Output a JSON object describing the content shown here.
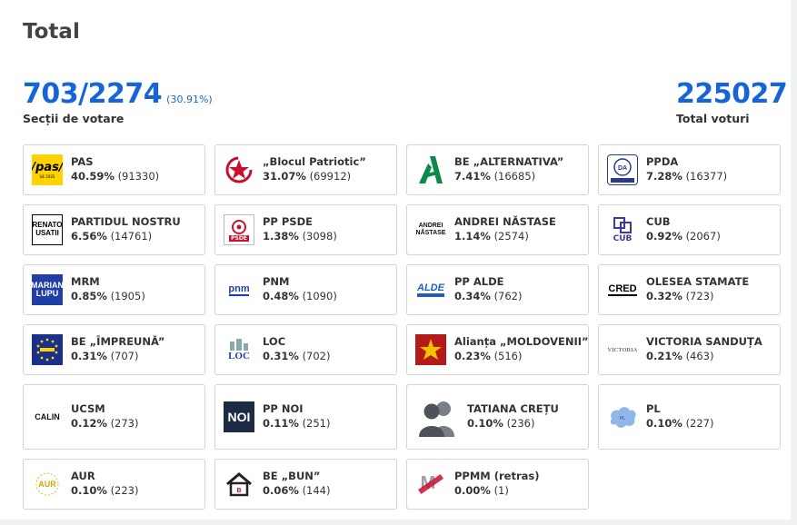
{
  "title": "Total",
  "stations": {
    "value": "703/2274",
    "percent": "(30.91%)",
    "label": "Secții de votare"
  },
  "votes": {
    "value": "225027",
    "label": "Total voturi"
  },
  "parties": [
    {
      "name": "PAS",
      "pct": "40.59%",
      "votes": "(91330)",
      "logo": "pas-logo",
      "logo_text": "/pas/"
    },
    {
      "name": "„Blocul Patriotic”",
      "pct": "31.07%",
      "votes": "(69912)",
      "logo": "red-star-logo",
      "logo_text": ""
    },
    {
      "name": "BE „ALTERNATIVA”",
      "pct": "7.41%",
      "votes": "(16685)",
      "logo": "alternativa-logo",
      "logo_text": ""
    },
    {
      "name": "PPDA",
      "pct": "7.28%",
      "votes": "(16377)",
      "logo": "ppda-logo",
      "logo_text": "DA"
    },
    {
      "name": "PARTIDUL NOSTRU",
      "pct": "6.56%",
      "votes": "(14761)",
      "logo": "renato-usatii-logo",
      "logo_text": "RENATO USATII"
    },
    {
      "name": "PP PSDE",
      "pct": "1.38%",
      "votes": "(3098)",
      "logo": "psde-logo",
      "logo_text": "PSDE"
    },
    {
      "name": "ANDREI NĂSTASE",
      "pct": "1.14%",
      "votes": "(2574)",
      "logo": "andrei-nastase-logo",
      "logo_text": "ANDREI NĂSTASE"
    },
    {
      "name": "CUB",
      "pct": "0.92%",
      "votes": "(2067)",
      "logo": "cub-logo",
      "logo_text": "CUB"
    },
    {
      "name": "MRM",
      "pct": "0.85%",
      "votes": "(1905)",
      "logo": "marian-lupu-logo",
      "logo_text": "MARIAN LUPU"
    },
    {
      "name": "PNM",
      "pct": "0.48%",
      "votes": "(1090)",
      "logo": "pnm-logo",
      "logo_text": "pnm"
    },
    {
      "name": "PP ALDE",
      "pct": "0.34%",
      "votes": "(762)",
      "logo": "alde-logo",
      "logo_text": "ALDE"
    },
    {
      "name": "OLESEA STAMATE",
      "pct": "0.32%",
      "votes": "(723)",
      "logo": "cred-logo",
      "logo_text": "CRED"
    },
    {
      "name": "BE „ÎMPREUNĂ”",
      "pct": "0.31%",
      "votes": "(707)",
      "logo": "impreuna-logo",
      "logo_text": ""
    },
    {
      "name": "LOC",
      "pct": "0.31%",
      "votes": "(702)",
      "logo": "loc-logo",
      "logo_text": "LOC"
    },
    {
      "name": "Alianța „MOLDOVENII”",
      "pct": "0.23%",
      "votes": "(516)",
      "logo": "moldovenii-logo",
      "logo_text": ""
    },
    {
      "name": "VICTORIA SANDUȚA",
      "pct": "0.21%",
      "votes": "(463)",
      "logo": "victoria-logo",
      "logo_text": "VICTORIA"
    },
    {
      "name": "UCSM",
      "pct": "0.12%",
      "votes": "(273)",
      "logo": "calin-logo",
      "logo_text": "CALIN"
    },
    {
      "name": "PP NOI",
      "pct": "0.11%",
      "votes": "(251)",
      "logo": "noi-logo",
      "logo_text": "NOI"
    },
    {
      "name": "TATIANA CREȚU",
      "pct": "0.10%",
      "votes": "(236)",
      "logo": "persons-icon",
      "logo_text": ""
    },
    {
      "name": "PL",
      "pct": "0.10%",
      "votes": "(227)",
      "logo": "pl-logo",
      "logo_text": ""
    },
    {
      "name": "AUR",
      "pct": "0.10%",
      "votes": "(223)",
      "logo": "aur-logo",
      "logo_text": "AUR"
    },
    {
      "name": "BE „BUN”",
      "pct": "0.06%",
      "votes": "(144)",
      "logo": "bun-logo",
      "logo_text": ""
    },
    {
      "name": "PPMM (retras)",
      "pct": "0.00%",
      "votes": "(1)",
      "logo": "ppmm-logo",
      "logo_text": ""
    }
  ],
  "colors": {
    "accent": "#1565d8",
    "pas_yellow": "#ffd200",
    "blocul_red": "#c8102e",
    "alternativa_green": "#0a8a4a"
  }
}
